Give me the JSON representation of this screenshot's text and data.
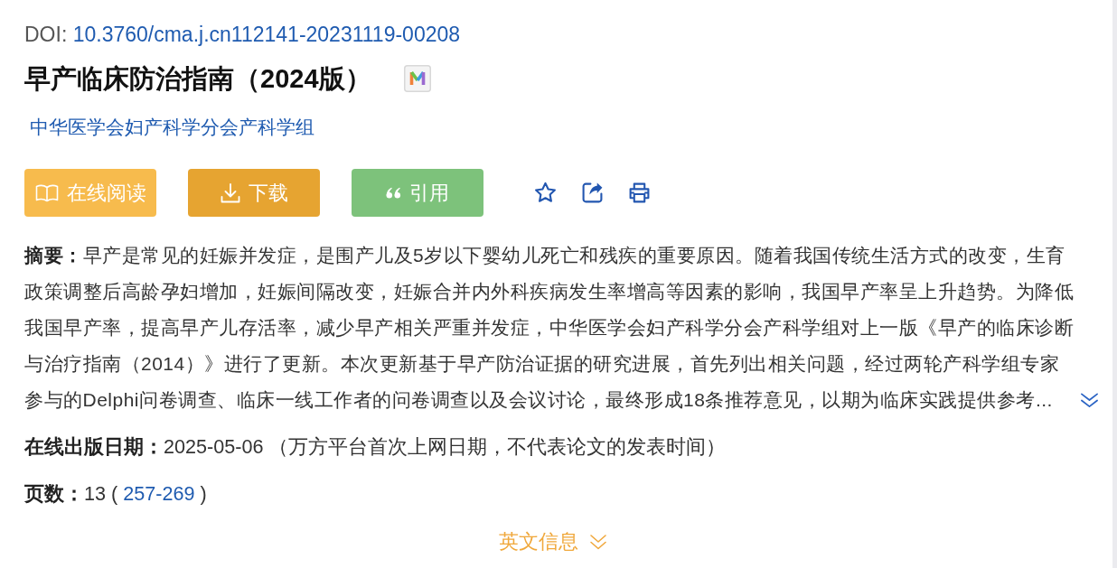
{
  "doi": {
    "label": "DOI:",
    "value": "10.3760/cma.j.cn112141-20231119-00208"
  },
  "title": "早产临床防治指南（2024版）",
  "author": "中华医学会妇产科学分会产科学组",
  "actions": [
    {
      "kind": "read",
      "label": "在线阅读"
    },
    {
      "kind": "download",
      "label": "下载"
    },
    {
      "kind": "cite",
      "label": "引用"
    }
  ],
  "abstract": "**摘要：**早产是常见的妊娠并发症，是围产儿及5岁以下婴幼儿死亡和残疾的重要原因。随着我国传统生活方式的改变，生育政策调整后高龄孕妇增加，妊娠间隔改变，妊娠合并内外科疾病发生率增高等因素的影响，我国早产率呈上升趋势。为降低我国早产率，提高早产儿存活率，减少早产相关严重并发症，中华医学会妇产科学分会产科学组对上一版《早产的临床诊断与治疗指南（2014）》进行了更新。本次更新基于早产防治证据的研究进展，首先列出相关问题，经过两轮产科学组专家参与的Delphi问卷调查、临床一线工作者的问卷调查以及会议讨论，最终形成18条推荐意见，以期为临床实践提供参考...",
  "online_date": "**在线出版日期：**2025-05-06 （万方平台首次上网日期，不代表论文的发表时间）",
  "pages": {
    "text": "**页数：**13 (",
    "range": "257-269",
    "close": ")"
  },
  "english_info": "英文信息"
}
